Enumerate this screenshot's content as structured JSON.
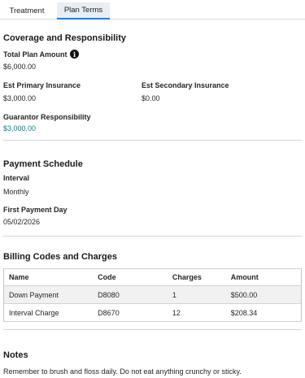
{
  "tabs": [
    {
      "label": "Treatment",
      "active": false
    },
    {
      "label": "Plan Terms",
      "active": true
    }
  ],
  "coverage": {
    "title": "Coverage and Responsibility",
    "total_label": "Total Plan Amount",
    "total_value": "$6,000.00",
    "primary_label": "Est Primary Insurance",
    "primary_value": "$3,000.00",
    "secondary_label": "Est Secondary Insurance",
    "secondary_value": "$0.00",
    "guarantor_label": "Guarantor Responsibility",
    "guarantor_value": "$3,000.00"
  },
  "payment": {
    "title": "Payment Schedule",
    "interval_label": "Interval",
    "interval_value": "Monthly",
    "first_label": "First Payment Day",
    "first_value": "05/02/2026"
  },
  "billing": {
    "title": "Billing Codes and Charges",
    "columns": [
      "Name",
      "Code",
      "Charges",
      "Amount"
    ],
    "rows": [
      [
        "Down Payment",
        "D8080",
        "1",
        "$500.00"
      ],
      [
        "Interval Charge",
        "D8670",
        "12",
        "$208.34"
      ]
    ]
  },
  "notes": {
    "title": "Notes",
    "text": "Remember to brush and floss daily. Do not eat anything crunchy or sticky."
  },
  "colors": {
    "accent": "#2a7cc7",
    "link_teal": "#1b7c86",
    "active_tab_bg": "#e7eef5"
  }
}
